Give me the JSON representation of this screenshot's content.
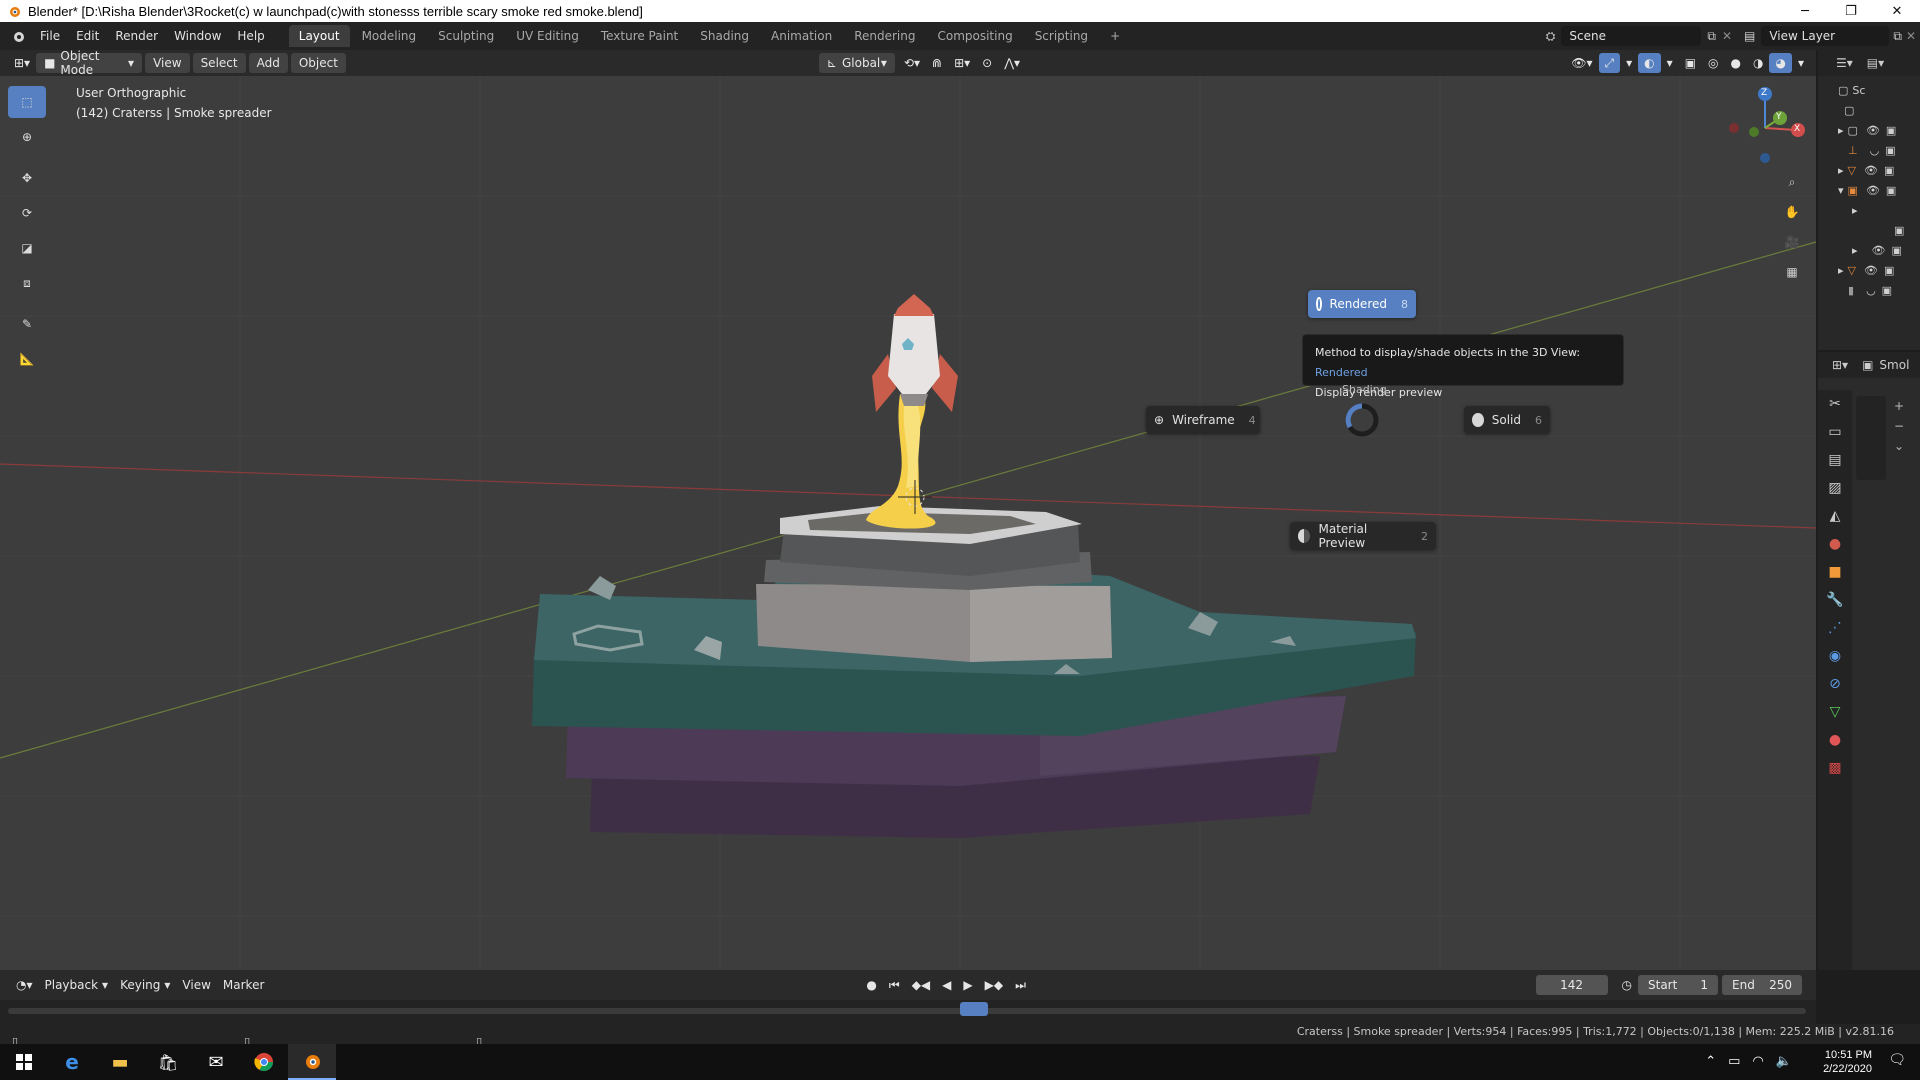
{
  "window": {
    "title": "Blender* [D:\\Risha Blender\\3Rocket(c) w launchpad(c)with stonesss terrible scary smoke red smoke.blend]",
    "minimize": "─",
    "maximize": "❐",
    "close": "✕"
  },
  "menus": [
    "File",
    "Edit",
    "Render",
    "Window",
    "Help"
  ],
  "workspaces": [
    "Layout",
    "Modeling",
    "Sculpting",
    "UV Editing",
    "Texture Paint",
    "Shading",
    "Animation",
    "Rendering",
    "Compositing",
    "Scripting"
  ],
  "workspace_add": "+",
  "scene": "Scene",
  "view_layer": "View Layer",
  "viewport_header": {
    "mode": "Object Mode",
    "menus": [
      "View",
      "Select",
      "Add",
      "Object"
    ],
    "transform_orientation": "Global"
  },
  "viewport": {
    "view_name": "User Orthographic",
    "object_info": "(142) Craterss | Smoke spreader",
    "axis_x": "X",
    "axis_y": "Y",
    "axis_z": "Z"
  },
  "pie_menu": {
    "title": "Shading",
    "rendered": {
      "label": "Rendered",
      "key": "8"
    },
    "wireframe": {
      "label": "Wireframe",
      "key": "4"
    },
    "solid": {
      "label": "Solid",
      "key": "6"
    },
    "material": {
      "label": "Material Preview",
      "key": "2"
    }
  },
  "tooltip": {
    "line1": "Method to display/shade objects in the 3D View: ",
    "line1_value": "Rendered",
    "line2": "Display render preview"
  },
  "outliner": {
    "header": "Sc"
  },
  "properties": {
    "header": "Smol"
  },
  "timeline": {
    "menus": [
      "Playback",
      "Keying",
      "View",
      "Marker"
    ],
    "current_frame": "142",
    "start_label": "Start",
    "start": "1",
    "end_label": "End",
    "end": "250"
  },
  "status": {
    "text": "Craterss | Smoke spreader | Verts:954 | Faces:995 | Tris:1,772 | Objects:0/1,138 | Mem: 225.2 MiB | v2.81.16"
  },
  "taskbar": {
    "time": "10:51 PM",
    "date": "2/22/2020"
  },
  "colors": {
    "accent": "#5680c2",
    "viewport_bg": "#3d3d3d",
    "header_bg": "#2a2a2a"
  }
}
